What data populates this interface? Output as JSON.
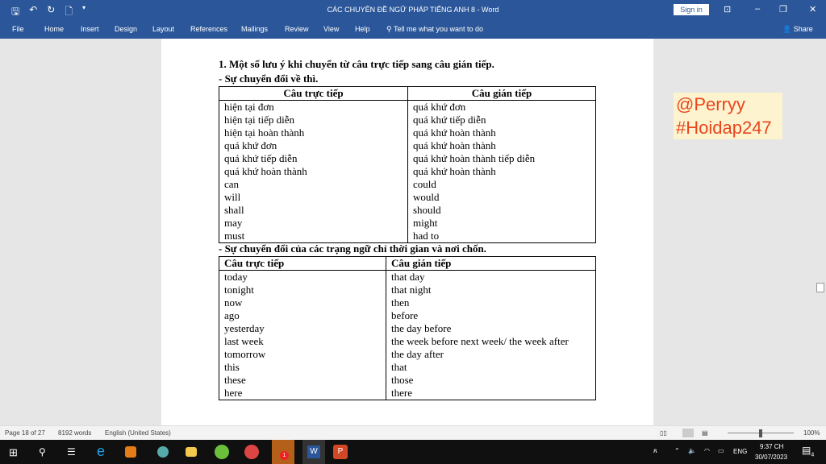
{
  "window": {
    "title": "CÁC CHUYÊN ĐỀ NGỮ PHÁP TIẾNG ANH 8 - Word",
    "sign_in": "Sign in"
  },
  "ribbon": {
    "tabs": [
      "File",
      "Home",
      "Insert",
      "Design",
      "Layout",
      "References",
      "Mailings",
      "Review",
      "View",
      "Help"
    ],
    "tell_me": "Tell me what you want to do",
    "share": "Share"
  },
  "doc": {
    "heading": "1. Một số lưu ý khi chuyển từ câu trực tiếp sang câu gián tiếp.",
    "sub1": "- Sự chuyển đổi về thì.",
    "table1": {
      "headers": [
        "Câu trực tiếp",
        "Câu gián tiếp"
      ],
      "rows": [
        [
          "hiện tại đơn",
          "quá khứ đơn"
        ],
        [
          "hiện tại tiếp diễn",
          "quá khứ tiếp diễn"
        ],
        [
          "hiện tại hoàn thành",
          "quá khứ hoàn thành"
        ],
        [
          "quá khứ đơn",
          "quá khứ hoàn thành"
        ],
        [
          "quá khứ tiếp diễn",
          "quá khứ hoàn thành tiếp diễn"
        ],
        [
          "quá khứ hoàn thành",
          "quá khứ hoàn thành"
        ],
        [
          "can",
          "could"
        ],
        [
          "will",
          "would"
        ],
        [
          "shall",
          "should"
        ],
        [
          "may",
          "might"
        ],
        [
          "must",
          "had to"
        ]
      ]
    },
    "sub2": "- Sự chuyển đổi của các trạng ngữ chỉ thời gian và nơi chốn.",
    "table2": {
      "headers": [
        "Câu trực tiếp",
        "Câu gián tiếp"
      ],
      "rows": [
        [
          "today",
          "that day"
        ],
        [
          "tonight",
          "that night"
        ],
        [
          "now",
          "then"
        ],
        [
          "ago",
          "before"
        ],
        [
          "yesterday",
          "the day before"
        ],
        [
          "last week",
          "the week before next week/ the week after"
        ],
        [
          "tomorrow",
          "the day after"
        ],
        [
          "this",
          "that"
        ],
        [
          "these",
          "those"
        ],
        [
          "here",
          "there"
        ]
      ]
    }
  },
  "watermark": [
    "@Perryy",
    "#Hoidap247"
  ],
  "status": {
    "page": "Page 18 of 27",
    "words": "8192 words",
    "language": "English (United States)",
    "zoom": "100%"
  },
  "taskbar": {
    "time": "9:37 CH",
    "date": "30/07/2023",
    "lang": "ENG",
    "badge": "1",
    "notifications": "4"
  }
}
